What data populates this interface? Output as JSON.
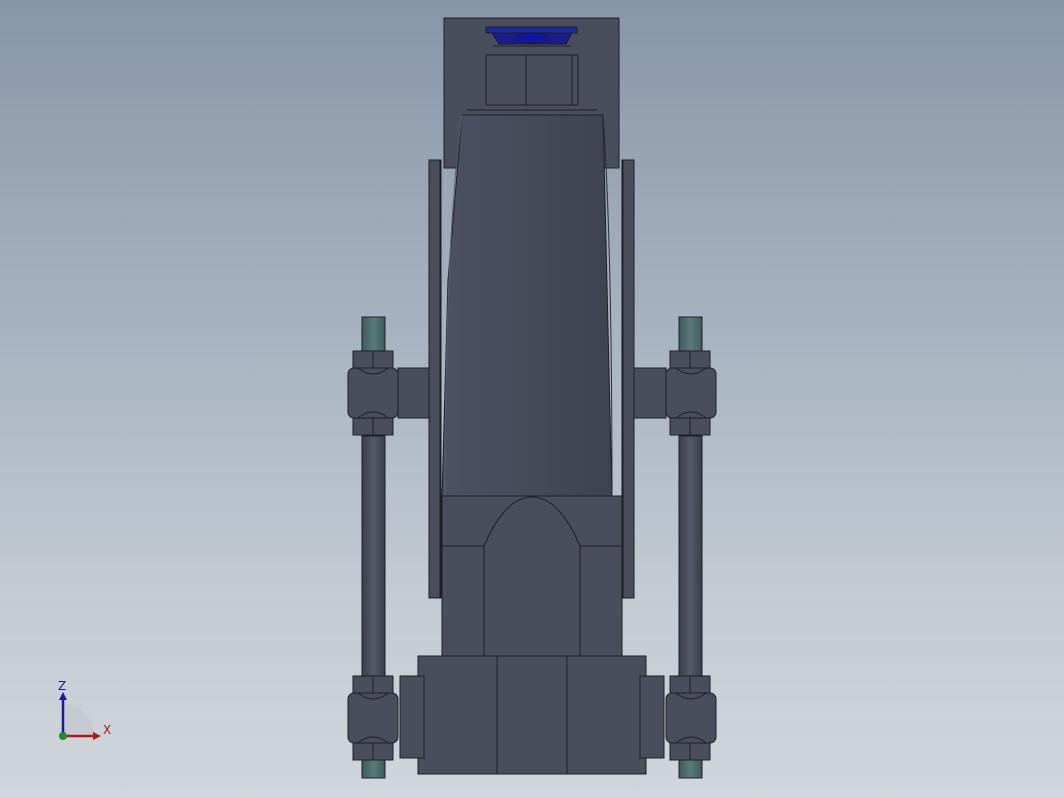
{
  "viewport": {
    "background_top": "#8796a8",
    "background_bottom": "#d0d6db",
    "model_color": "#4a4e5c",
    "edge_color": "#1d1f27",
    "rod_end_color": "#4f6d6e",
    "top_cap_color": "#1b2a9c"
  },
  "triad": {
    "z_label": "Z",
    "x_label": "X",
    "z_color": "#1a1a99",
    "x_color": "#aa1b1b",
    "origin_color": "#1d8a2c"
  }
}
